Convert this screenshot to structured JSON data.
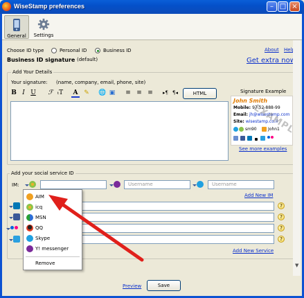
{
  "window": {
    "title": "WiseStamp preferences"
  },
  "toolbar": {
    "general_label": "General",
    "settings_label": "Settings"
  },
  "top": {
    "choose_id_type": "Choose ID type",
    "personal_id": "Personal ID",
    "business_id": "Business ID",
    "about": "About",
    "help": "Help",
    "signature_title": "Business ID signature",
    "signature_default": "(default)",
    "get_extra": "Get extra now"
  },
  "details": {
    "group_title": "Add Your Details",
    "your_signature": "Your signature:",
    "hint": "(name, company, email, phone, site)",
    "html_button": "HTML",
    "signature_example_title": "Signature Example",
    "see_more": "See more examples"
  },
  "signature_example": {
    "name": "John Smith",
    "mobile_label": "Mobile:",
    "mobile_value": "97 52-888-99",
    "email_label": "Email:",
    "email_value": "jh@wisestamp.com",
    "site_label": "Site:",
    "site_value": "wisestamp.co.il",
    "contact1": "sm90",
    "contact2": "John1",
    "watermark": "EXAMPLE"
  },
  "social": {
    "group_title": "Add your social service ID",
    "im_label": "IM:",
    "username_placeholder": "Username",
    "add_new_im": "Add New IM",
    "add_new_service": "Add New Service"
  },
  "menu": {
    "items": [
      {
        "label": "AIM",
        "icon": "aim-icon"
      },
      {
        "label": "icq",
        "icon": "icq-icon"
      },
      {
        "label": "MSN",
        "icon": "msn-icon"
      },
      {
        "label": "QQ",
        "icon": "qq-icon"
      },
      {
        "label": "Skype",
        "icon": "skype-icon"
      },
      {
        "label": "Y! messenger",
        "icon": "yahoo-icon"
      }
    ],
    "remove": "Remove"
  },
  "footer": {
    "preview": "Preview",
    "save": "Save"
  },
  "colors": {
    "titlebar": "#0450c9",
    "link": "#0a2fcb",
    "accent_orange": "#e07b00",
    "arrow_red": "#e0201b"
  }
}
